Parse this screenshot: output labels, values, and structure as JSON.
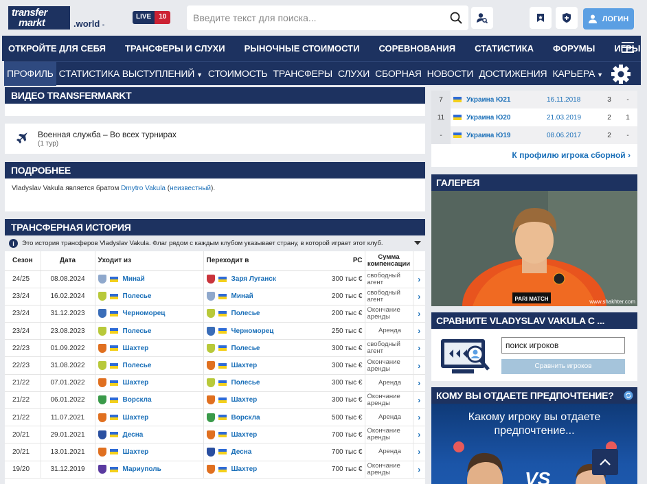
{
  "header": {
    "logo_line1": "transfer",
    "logo_line2": "markt",
    "domain": ".world",
    "domain_caret": "-",
    "live_label": "LIVE",
    "live_count": "10",
    "search_placeholder": "Введите текст для поиска...",
    "login_label": "ЛОГИН"
  },
  "main_nav": [
    "Откройте для себя",
    "Трансферы и слухи",
    "Рыночные стоимости",
    "Соревнования",
    "Статистика",
    "Форумы",
    "Игры"
  ],
  "sub_nav": [
    {
      "label": "Профиль",
      "active": true,
      "caret": false
    },
    {
      "label": "Статистика выступлений",
      "active": false,
      "caret": true
    },
    {
      "label": "Стоимость",
      "active": false,
      "caret": false
    },
    {
      "label": "Трансферы",
      "active": false,
      "caret": false
    },
    {
      "label": "Слухи",
      "active": false,
      "caret": false
    },
    {
      "label": "Сборная",
      "active": false,
      "caret": false
    },
    {
      "label": "Новости",
      "active": false,
      "caret": false
    },
    {
      "label": "Достижения",
      "active": false,
      "caret": false
    },
    {
      "label": "Карьера",
      "active": false,
      "caret": true
    }
  ],
  "video": {
    "title": "Видео Transfermarkt"
  },
  "military": {
    "title": "Военная служба – Во всех турнирах",
    "sub": "(1 тур)"
  },
  "details": {
    "title": "Подробнее",
    "text_pre": "Vladyslav Vakula является братом ",
    "brother": "Dmytro Vakula",
    "text_mid": " (",
    "unknown": "неизвестный",
    "text_post": ")."
  },
  "transfers": {
    "title": "Трансферная история",
    "info": "Это история трансферов Vladyslav Vakula. Флаг рядом с каждым клубом указывает страну, в которой играет этот клуб.",
    "columns": {
      "season": "Сезон",
      "date": "Дата",
      "from": "Уходит из",
      "to": "Переходит в",
      "mv": "РС",
      "fee": "Сумма компенсации"
    },
    "rows": [
      {
        "season": "24/25",
        "date": "08.08.2024",
        "from": "Минай",
        "from_color": "#8fa8cc",
        "to": "Заря Луганск",
        "to_color": "#c9343c",
        "mv": "300 тыс €",
        "fee": "свободный агент"
      },
      {
        "season": "23/24",
        "date": "16.02.2024",
        "from": "Полесье",
        "from_color": "#b8c93a",
        "to": "Минай",
        "to_color": "#8fa8cc",
        "mv": "200 тыс €",
        "fee": "свободный агент"
      },
      {
        "season": "23/24",
        "date": "31.12.2023",
        "from": "Черноморец",
        "from_color": "#3a6db8",
        "to": "Полесье",
        "to_color": "#b8c93a",
        "mv": "200 тыс €",
        "fee": "Окончание аренды"
      },
      {
        "season": "23/24",
        "date": "23.08.2023",
        "from": "Полесье",
        "from_color": "#b8c93a",
        "to": "Черноморец",
        "to_color": "#3a6db8",
        "mv": "250 тыс €",
        "fee": "Аренда"
      },
      {
        "season": "22/23",
        "date": "01.09.2022",
        "from": "Шахтер",
        "from_color": "#e07020",
        "to": "Полесье",
        "to_color": "#b8c93a",
        "mv": "300 тыс €",
        "fee": "свободный агент"
      },
      {
        "season": "22/23",
        "date": "31.08.2022",
        "from": "Полесье",
        "from_color": "#b8c93a",
        "to": "Шахтер",
        "to_color": "#e07020",
        "mv": "300 тыс €",
        "fee": "Окончание аренды"
      },
      {
        "season": "21/22",
        "date": "07.01.2022",
        "from": "Шахтер",
        "from_color": "#e07020",
        "to": "Полесье",
        "to_color": "#b8c93a",
        "mv": "300 тыс €",
        "fee": "Аренда"
      },
      {
        "season": "21/22",
        "date": "06.01.2022",
        "from": "Ворскла",
        "from_color": "#3a9a4a",
        "to": "Шахтер",
        "to_color": "#e07020",
        "mv": "300 тыс €",
        "fee": "Окончание аренды"
      },
      {
        "season": "21/22",
        "date": "11.07.2021",
        "from": "Шахтер",
        "from_color": "#e07020",
        "to": "Ворскла",
        "to_color": "#3a9a4a",
        "mv": "500 тыс €",
        "fee": "Аренда"
      },
      {
        "season": "20/21",
        "date": "29.01.2021",
        "from": "Десна",
        "from_color": "#2a4fa0",
        "to": "Шахтер",
        "to_color": "#e07020",
        "mv": "700 тыс €",
        "fee": "Окончание аренды"
      },
      {
        "season": "20/21",
        "date": "13.01.2021",
        "from": "Шахтер",
        "from_color": "#e07020",
        "to": "Десна",
        "to_color": "#2a4fa0",
        "mv": "700 тыс €",
        "fee": "Аренда"
      },
      {
        "season": "19/20",
        "date": "31.12.2019",
        "from": "Мариуполь",
        "from_color": "#5a3aa0",
        "to": "Шахтер",
        "to_color": "#e07020",
        "mv": "700 тыс €",
        "fee": "Окончание аренды"
      }
    ]
  },
  "national": {
    "rows": [
      {
        "n": "7",
        "team": "Украина Ю21",
        "date": "16.11.2018",
        "a": "3",
        "b": "-"
      },
      {
        "n": "11",
        "team": "Украина Ю20",
        "date": "21.03.2019",
        "a": "2",
        "b": "1"
      },
      {
        "n": "-",
        "team": "Украина Ю19",
        "date": "08.06.2017",
        "a": "2",
        "b": "-"
      }
    ],
    "link": "К профилю игрока сборной"
  },
  "gallery": {
    "title": "Галерея",
    "credit": "www.shakhter.com",
    "shirt_text": "PARI MATCH"
  },
  "compare": {
    "title": "Сравните Vladyslav Vakula с ...",
    "input_value": "поиск игроков",
    "button": "Сравнить игроков"
  },
  "poll": {
    "title": "Кому вы отдаете предпочтение?",
    "question": "Какому игроку вы отдаете предпочтение...",
    "vs": "VS"
  },
  "colors": {
    "navy": "#1d3260",
    "link": "#1a6fb8",
    "live_red": "#cc2233",
    "login_blue": "#5b9fe3"
  }
}
